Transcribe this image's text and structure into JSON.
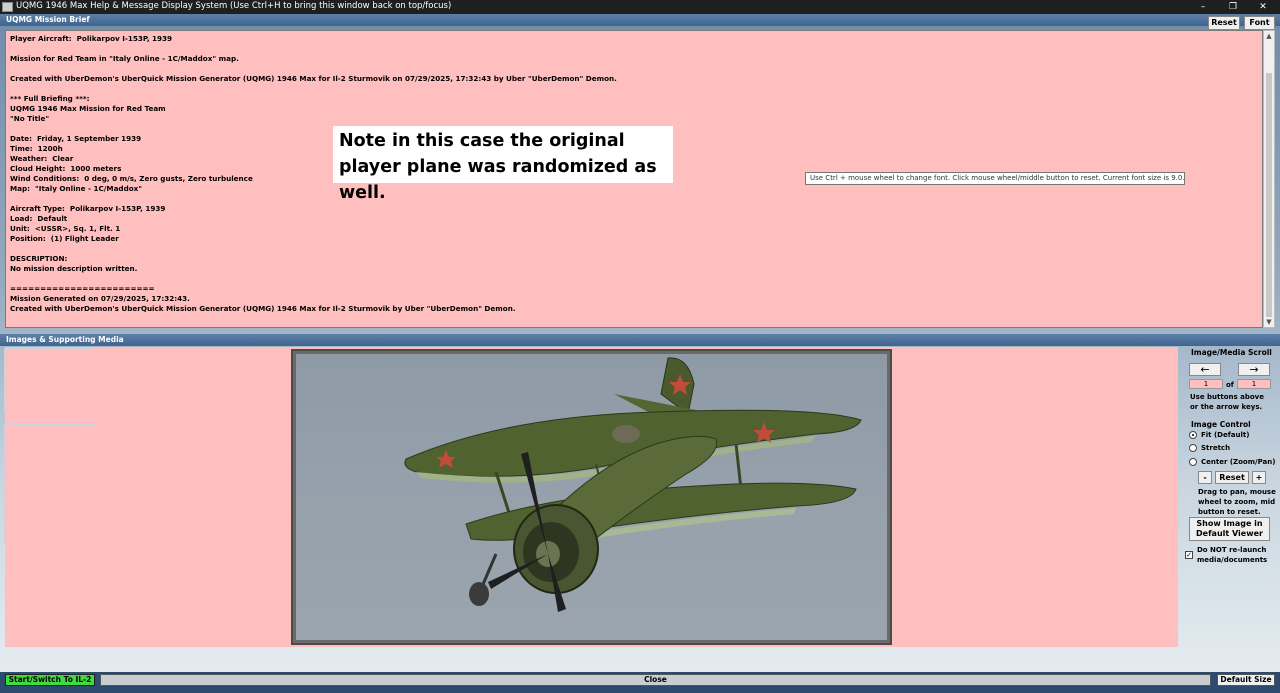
{
  "window": {
    "title": "UQMG 1946 Max Help & Message Display System (Use Ctrl+H to bring this window back on top/focus)",
    "minimize": "–",
    "restore": "❐",
    "close": "✕"
  },
  "brief": {
    "header": "UQMG Mission Brief",
    "reset_label": "Reset",
    "font_label": "Font",
    "text": "Player Aircraft:  Polikarpov I-153P, 1939\n\nMission for Red Team in \"Italy Online - 1C/Maddox\" map.\n\nCreated with UberDemon's UberQuick Mission Generator (UQMG) 1946 Max for Il-2 Sturmovik on 07/29/2025, 17:32:43 by Uber \"UberDemon\" Demon.\n\n*** Full Briefing ***:\nUQMG 1946 Max Mission for Red Team\n\"No Title\"\n\nDate:  Friday, 1 September 1939\nTime:  1200h\nWeather:  Clear\nCloud Height:  1000 meters\nWind Conditions:  0 deg, 0 m/s, Zero gusts, Zero turbulence\nMap:  \"Italy Online - 1C/Maddox\"\n\nAircraft Type:  Polikarpov I-153P, 1939\nLoad:  Default\nUnit:  <USSR>, Sq. 1, Flt. 1\nPosition:  (1) Flight Leader\n\nDESCRIPTION:\nNo mission description written.\n\n========================\nMission Generated on 07/29/2025, 17:32:43.\nCreated with UberDemon's UberQuick Mission Generator (UQMG) 1946 Max for Il-2 Sturmovik by Uber \"UberDemon\" Demon."
  },
  "note": "Note in this case the original player plane was randomized as well.",
  "tooltip": "Use Ctrl + mouse wheel to change font. Click mouse wheel/middle button to reset. Current font size is 9.0.",
  "media": {
    "header": "Images & Supporting Media",
    "scroll_group": "Image/Media Scroll",
    "prev_arrow": "←",
    "next_arrow": "→",
    "current_page": "1",
    "of_label": "of",
    "total_pages": "1",
    "scroll_hint_1": "Use buttons above",
    "scroll_hint_2": "or the arrow keys.",
    "control_group": "Image Control",
    "fit_label": "Fit (Default)",
    "stretch_label": "Stretch",
    "center_label": "Center (Zoom/Pan)",
    "zoom_out": "-",
    "zoom_reset": "Reset",
    "zoom_in": "+",
    "drag_hint_1": "Drag to pan, mouse",
    "drag_hint_2": "wheel to zoom, mid",
    "drag_hint_3": "button to reset.",
    "show_image_1": "Show Image in",
    "show_image_2": "Default Viewer",
    "relaunch_1": "Do NOT re-launch",
    "relaunch_2": "media/documents",
    "relaunch_checked": "✓"
  },
  "footer": {
    "start_label": "Start/Switch To IL-2",
    "close_label": "Close",
    "default_size_label": "Default Size"
  }
}
